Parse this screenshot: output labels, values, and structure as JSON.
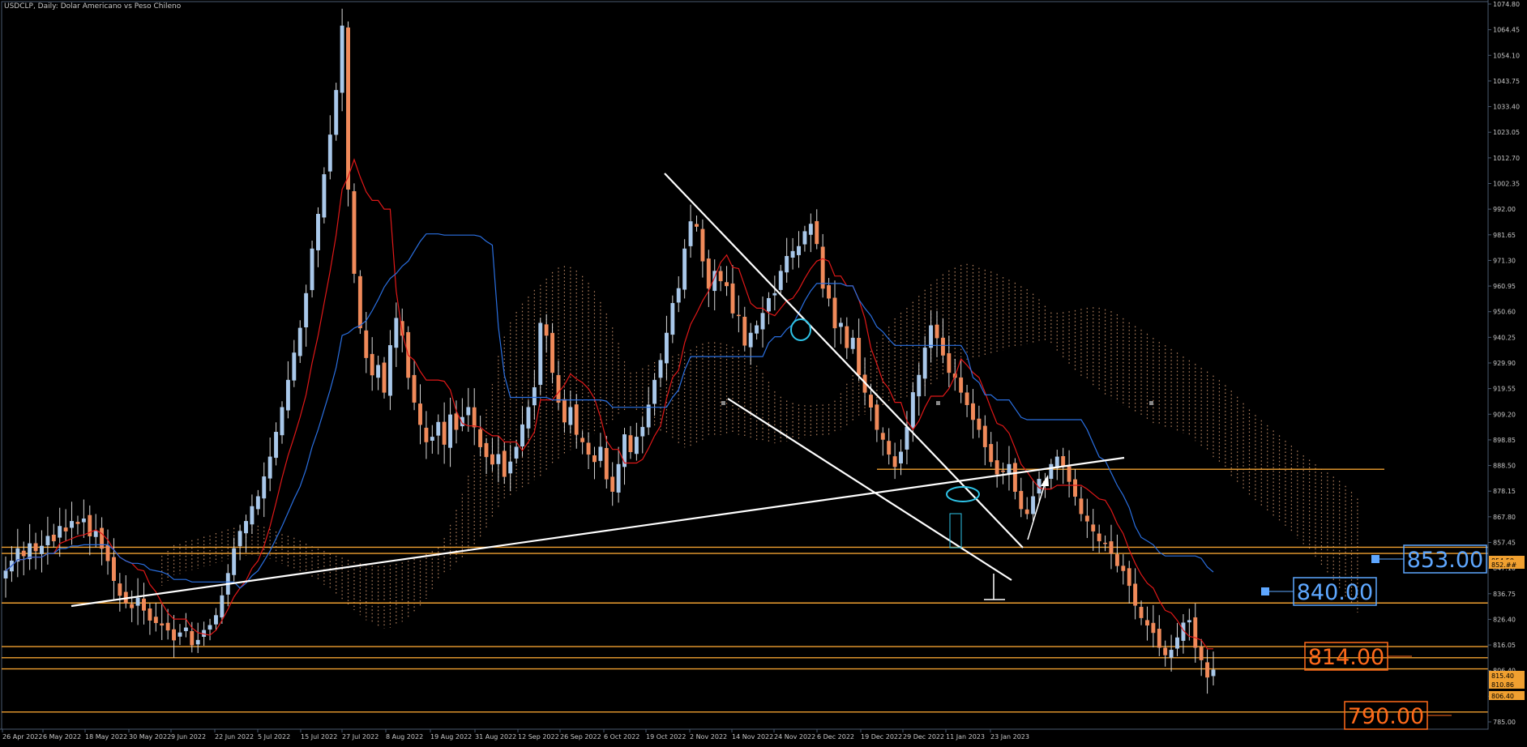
{
  "header": {
    "title": "USDCLP, Daily:  Dolar Americano vs Peso Chileno"
  },
  "colors": {
    "background": "#000000",
    "axis": "#4a5a70",
    "bull_candle": "#a9c8ea",
    "bear_candle": "#f08a5a",
    "tenkan": "#e01818",
    "kijun": "#2a6fe0",
    "kumo": "#d59b72",
    "levels": "#f0a030",
    "trendlines": "#ffffff",
    "ellipse": "#2ec4e8",
    "label_blue": "#5ea7ff",
    "label_orange": "#ff6a1a"
  },
  "chart_data": {
    "type": "candlestick",
    "symbol": "USDCLP",
    "timeframe": "Daily",
    "y_axis_ticks": [
      "1074.80",
      "1064.45",
      "1054.10",
      "1043.75",
      "1033.40",
      "1023.05",
      "1012.70",
      "1002.35",
      "992.00",
      "981.65",
      "971.30",
      "960.95",
      "950.60",
      "940.25",
      "929.90",
      "919.55",
      "909.20",
      "898.85",
      "888.50",
      "878.15",
      "867.80",
      "857.45",
      "847.10",
      "836.75",
      "826.40",
      "816.05",
      "806.40",
      "795.35",
      "785.00"
    ],
    "x_axis_ticks": [
      "26 Apr 2022",
      "6 May 2022",
      "18 May 2022",
      "30 May 2022",
      "9 Jun 2022",
      "22 Jun 2022",
      "5 Jul 2022",
      "15 Jul 2022",
      "27 Jul 2022",
      "8 Aug 2022",
      "19 Aug 2022",
      "31 Aug 2022",
      "12 Sep 2022",
      "26 Sep 2022",
      "6 Oct 2022",
      "19 Oct 2022",
      "2 Nov 2022",
      "14 Nov 2022",
      "24 Nov 2022",
      "6 Dec 2022",
      "19 Dec 2022",
      "29 Dec 2022",
      "11 Jan 2023",
      "23 Jan 2023"
    ],
    "ylim": [
      785.0,
      1074.8
    ],
    "price_flags": [
      "854.50",
      "852.##",
      "815.40",
      "810.86",
      "806.40"
    ],
    "level_labels": [
      {
        "text": "853.00",
        "color": "blue"
      },
      {
        "text": "840.00",
        "color": "blue"
      },
      {
        "text": "814.00",
        "color": "orange"
      },
      {
        "text": "790.00",
        "color": "orange"
      }
    ],
    "horizontal_levels": [
      855.5,
      853.0,
      833.0,
      815.4,
      810.9,
      806.4,
      789.0,
      887.0
    ],
    "closes": [
      846,
      850,
      855,
      852,
      857,
      854,
      856,
      860,
      858,
      864,
      862,
      866,
      865,
      867,
      860,
      862,
      855,
      850,
      842,
      836,
      833,
      831,
      835,
      830,
      826,
      825,
      824,
      822,
      818,
      821,
      823,
      816,
      818,
      822,
      824,
      828,
      836,
      845,
      855,
      862,
      866,
      872,
      876,
      884,
      892,
      902,
      912,
      923,
      934,
      944,
      958,
      976,
      990,
      1006,
      1022,
      1040,
      1066,
      1000,
      966,
      944,
      932,
      925,
      929,
      918,
      937,
      948,
      941,
      924,
      914,
      905,
      898,
      900,
      906,
      897,
      909,
      903,
      908,
      912,
      904,
      896,
      892,
      889,
      893,
      884,
      890,
      896,
      905,
      912,
      920,
      946,
      941,
      926,
      914,
      906,
      912,
      901,
      898,
      893,
      890,
      896,
      883,
      878,
      889,
      901,
      894,
      900,
      904,
      913,
      923,
      931,
      942,
      954,
      960,
      976,
      987,
      985,
      971,
      960,
      967,
      963,
      961,
      950,
      949,
      937,
      942,
      945,
      950,
      956,
      958,
      967,
      973,
      975,
      977,
      983,
      986,
      978,
      960,
      956,
      944,
      946,
      936,
      940,
      925,
      918,
      912,
      903,
      899,
      893,
      888,
      894,
      904,
      918,
      925,
      936,
      945,
      940,
      933,
      926,
      924,
      918,
      913,
      907,
      903,
      896,
      890,
      885,
      886,
      889,
      878,
      871,
      869,
      876,
      883,
      882,
      889,
      892,
      888,
      882,
      876,
      869,
      866,
      862,
      858,
      857,
      853,
      848,
      846,
      840,
      832,
      827,
      824,
      821,
      815,
      812,
      814,
      819,
      825,
      826,
      815,
      810,
      803,
      806
    ]
  }
}
